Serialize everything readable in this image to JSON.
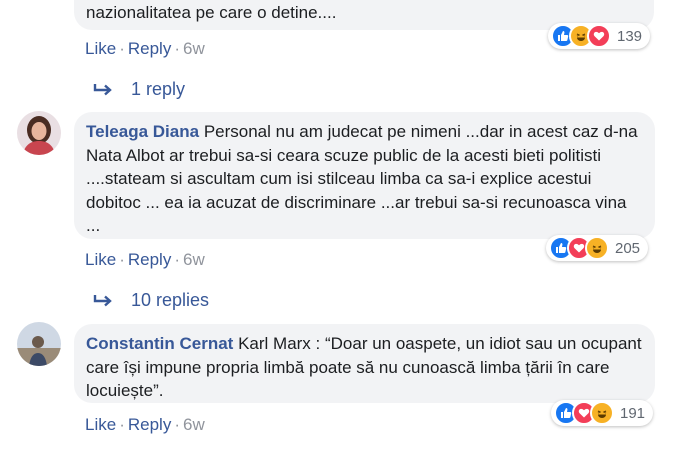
{
  "actions": {
    "like": "Like",
    "reply": "Reply",
    "sep": "·"
  },
  "comments": [
    {
      "author": "",
      "text": "nazionalitatea pe care o detine....",
      "time": "6w",
      "reaction_count": "139",
      "reactions": [
        "like-icon",
        "haha-icon",
        "love-icon"
      ],
      "replies_label": "1 reply"
    },
    {
      "author": "Teleaga Diana",
      "text": "Personal nu am judecat pe nimeni ...dar in acest caz d-na Nata Albot ar trebui sa-si ceara scuze public de la acesti bieti politisti ....stateam si ascultam cum isi stilceau limba ca sa-i explice acestui dobitoc ... ea ia acuzat de discriminare ...ar trebui sa-si recunoasca vina ...",
      "time": "6w",
      "reaction_count": "205",
      "reactions": [
        "like-icon",
        "love-icon",
        "haha-icon"
      ],
      "replies_label": "10 replies"
    },
    {
      "author": "Constantin Cernat",
      "text": "Karl Marx : “Doar un oaspete, un idiot sau un ocupant care își impune propria limbă poate să nu cunoască limba țării în care locuiește”.",
      "time": "6w",
      "reaction_count": "191",
      "reactions": [
        "like-icon",
        "love-icon",
        "haha-icon"
      ]
    }
  ],
  "colors": {
    "link": "#385898",
    "bubble": "#f2f3f5",
    "like": "#1877f2",
    "love": "#f33e58",
    "haha": "#f7b125"
  }
}
